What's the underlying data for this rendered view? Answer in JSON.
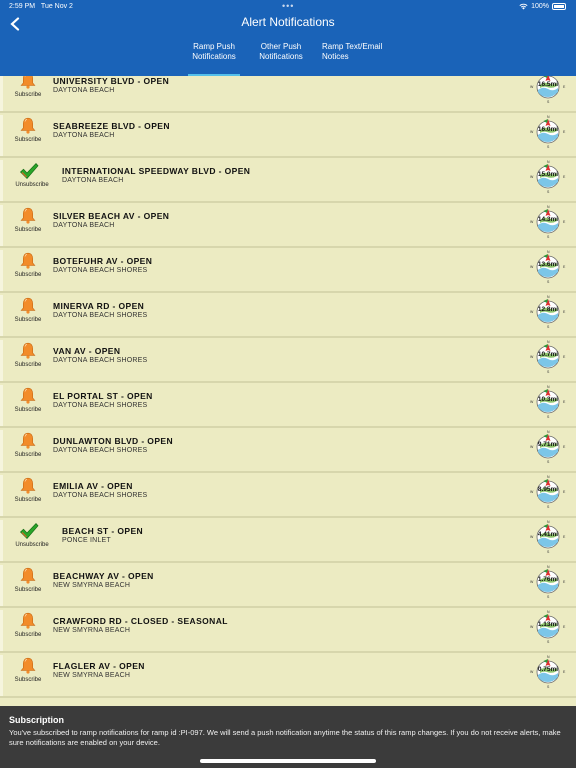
{
  "status_bar": {
    "time": "2:59 PM",
    "date": "Tue Nov 2",
    "battery": "100%"
  },
  "header": {
    "title": "Alert Notifications",
    "back_icon": "chevron-left-icon"
  },
  "tabs": [
    {
      "label": "Ramp Push Notifications",
      "line1": "Ramp Push",
      "line2": "Notifications",
      "active": true
    },
    {
      "label": "Other Push Notifications",
      "line1": "Other Push",
      "line2": "Notifications",
      "active": false
    },
    {
      "label": "Ramp Text/Email Notices",
      "line1": "Ramp Text/Email",
      "line2": "Notices",
      "active": false
    }
  ],
  "colors": {
    "header": "#1a63b8",
    "list_bg": "#ecebc2",
    "tab_indicator": "#54c0ea",
    "bell": "#f28c2a",
    "check": "#2aa52a"
  },
  "compass_letters": {
    "n": "N",
    "s": "S",
    "e": "E",
    "w": "W"
  },
  "ramps": [
    {
      "name": "UNIVERSITY BLVD - OPEN",
      "city": "DAYTONA BEACH",
      "action": "Subscribe",
      "subscribed": false,
      "distance": "16.5mi"
    },
    {
      "name": "SEABREEZE BLVD - OPEN",
      "city": "DAYTONA BEACH",
      "action": "Subscribe",
      "subscribed": false,
      "distance": "16.0mi"
    },
    {
      "name": "INTERNATIONAL SPEEDWAY BLVD - OPEN",
      "city": "DAYTONA BEACH",
      "action": "Unsubscribe",
      "subscribed": true,
      "distance": "15.0mi"
    },
    {
      "name": "SILVER BEACH AV - OPEN",
      "city": "DAYTONA BEACH",
      "action": "Subscribe",
      "subscribed": false,
      "distance": "14.3mi"
    },
    {
      "name": "BOTEFUHR AV - OPEN",
      "city": "DAYTONA BEACH SHORES",
      "action": "Subscribe",
      "subscribed": false,
      "distance": "13.6mi"
    },
    {
      "name": "MINERVA RD - OPEN",
      "city": "DAYTONA BEACH SHORES",
      "action": "Subscribe",
      "subscribed": false,
      "distance": "12.8mi"
    },
    {
      "name": "VAN AV - OPEN",
      "city": "DAYTONA BEACH SHORES",
      "action": "Subscribe",
      "subscribed": false,
      "distance": "10.7mi"
    },
    {
      "name": "EL PORTAL ST - OPEN",
      "city": "DAYTONA BEACH SHORES",
      "action": "Subscribe",
      "subscribed": false,
      "distance": "10.3mi"
    },
    {
      "name": "DUNLAWTON BLVD - OPEN",
      "city": "DAYTONA BEACH SHORES",
      "action": "Subscribe",
      "subscribed": false,
      "distance": "9.71mi"
    },
    {
      "name": "EMILIA AV - OPEN",
      "city": "DAYTONA BEACH SHORES",
      "action": "Subscribe",
      "subscribed": false,
      "distance": "8.95mi"
    },
    {
      "name": "BEACH ST - OPEN",
      "city": "PONCE INLET",
      "action": "Unsubscribe",
      "subscribed": true,
      "distance": "4.41mi"
    },
    {
      "name": "BEACHWAY AV - OPEN",
      "city": "NEW SMYRNA BEACH",
      "action": "Subscribe",
      "subscribed": false,
      "distance": "1.76mi"
    },
    {
      "name": "CRAWFORD RD - CLOSED - SEASONAL",
      "city": "NEW SMYRNA BEACH",
      "action": "Subscribe",
      "subscribed": false,
      "distance": "1.13mi"
    },
    {
      "name": "FLAGLER AV - OPEN",
      "city": "NEW SMYRNA BEACH",
      "action": "Subscribe",
      "subscribed": false,
      "distance": "0.75mi"
    }
  ],
  "toast": {
    "title": "Subscription",
    "message": "You've subscribed to ramp notifications for ramp id :PI-097.  We will send a push notification anytime the status of this ramp changes.  If you do not receive alerts, make sure notifications are enabled on your device."
  }
}
